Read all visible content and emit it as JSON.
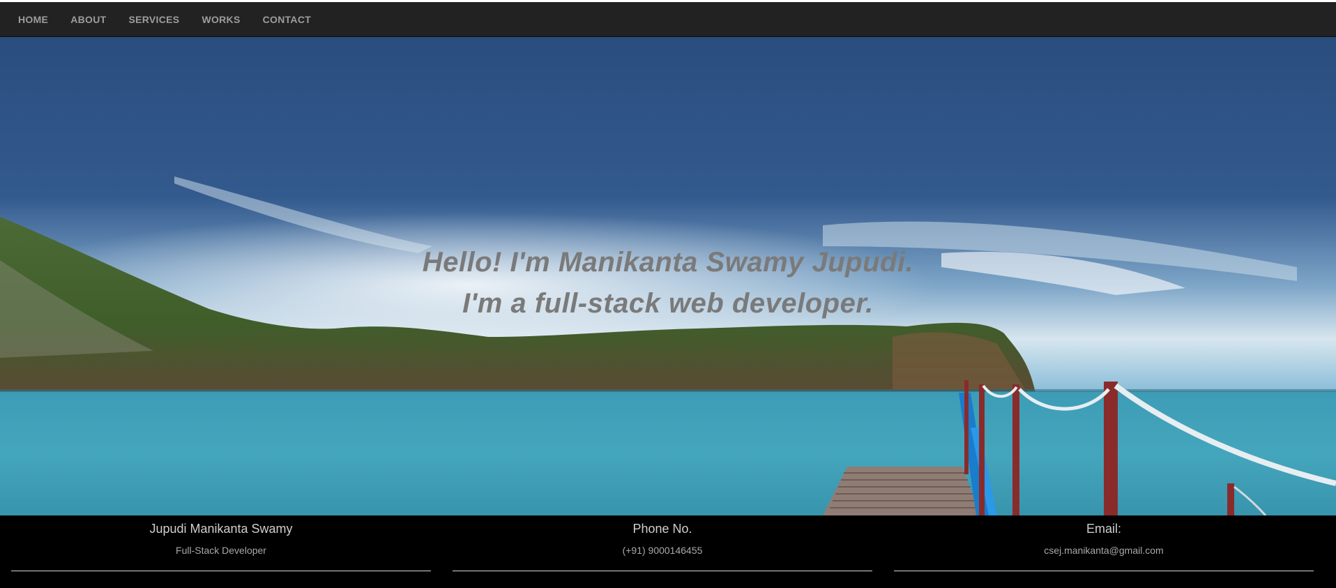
{
  "nav": {
    "items": [
      {
        "label": "HOME"
      },
      {
        "label": "ABOUT"
      },
      {
        "label": "SERVICES"
      },
      {
        "label": "WORKS"
      },
      {
        "label": "CONTACT"
      }
    ]
  },
  "hero": {
    "line1": "Hello! I'm Manikanta Swamy Jupudi.",
    "line2": "I'm a full-stack web developer."
  },
  "footer": {
    "columns": [
      {
        "heading": "Jupudi Manikanta Swamy",
        "sub": "Full-Stack Developer"
      },
      {
        "heading": "Phone No.",
        "sub": "(+91) 9000146455"
      },
      {
        "heading": "Email:",
        "sub": "csej.manikanta@gmail.com"
      }
    ]
  },
  "colors": {
    "navbar_bg": "#222222",
    "nav_text": "#9d9d9d",
    "hero_text": "#7a7a7a",
    "footer_bg": "#000000"
  }
}
